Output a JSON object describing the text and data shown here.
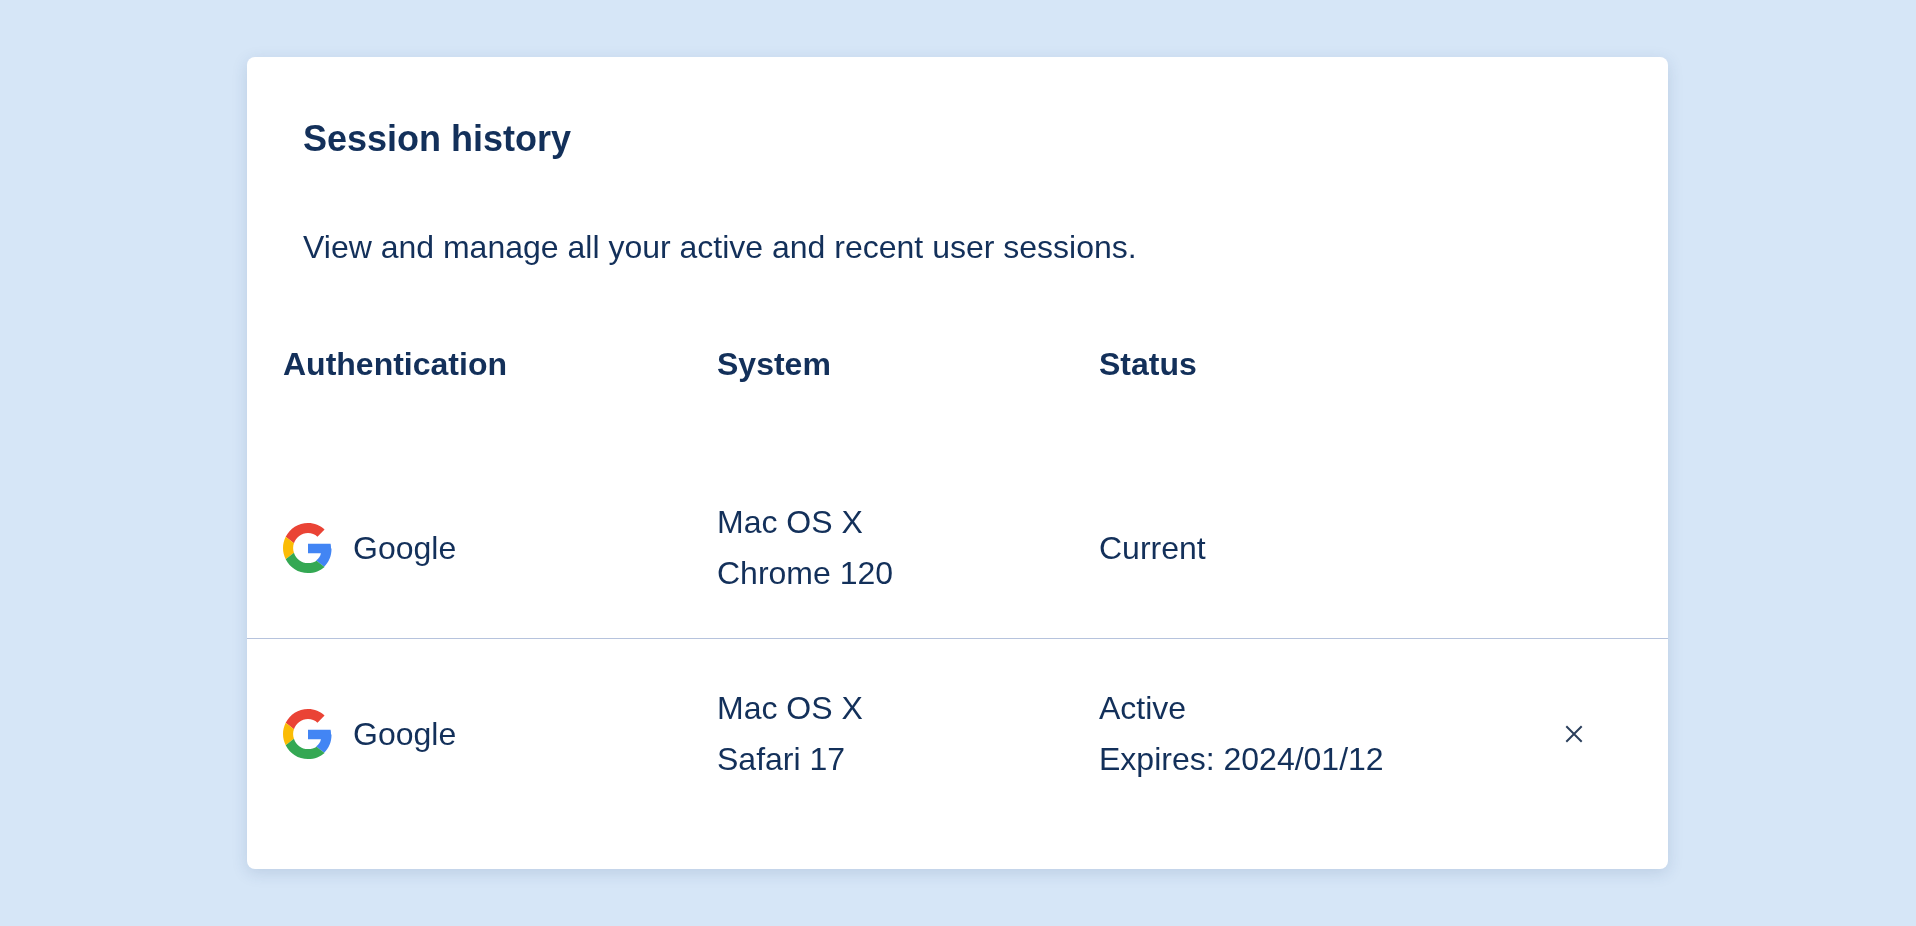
{
  "card": {
    "title": "Session history",
    "description": "View and manage all your active and recent user sessions."
  },
  "table": {
    "columns": [
      "Authentication",
      "System",
      "Status"
    ],
    "rows": [
      {
        "provider": "Google",
        "system": [
          "Mac OS X",
          "Chrome 120"
        ],
        "status": [
          "Current"
        ],
        "removable": false
      },
      {
        "provider": "Google",
        "system": [
          "Mac OS X",
          "Safari 17"
        ],
        "status": [
          "Active",
          "Expires: 2024/01/12"
        ],
        "removable": true
      }
    ]
  }
}
